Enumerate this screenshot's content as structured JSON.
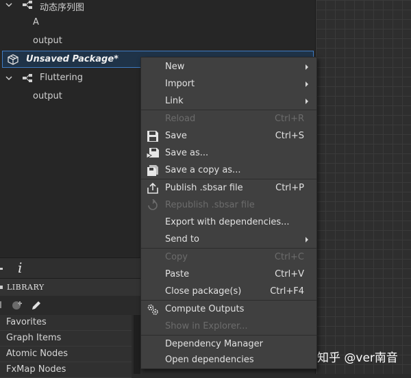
{
  "explorer": {
    "rows": [
      {
        "label": "动态序列图"
      },
      {
        "label": "A"
      },
      {
        "label": "output"
      },
      {
        "label": "Unsaved Package*"
      },
      {
        "label": "Fluttering"
      },
      {
        "label": "output"
      }
    ]
  },
  "toolbar": {
    "info_glyph": "i"
  },
  "library": {
    "title": "LIBRARY",
    "items": [
      "Favorites",
      "Graph Items",
      "Atomic Nodes",
      "FxMap Nodes"
    ]
  },
  "menu": {
    "items": [
      {
        "label": "New",
        "shortcut": ""
      },
      {
        "label": "Import",
        "shortcut": ""
      },
      {
        "label": "Link",
        "shortcut": ""
      },
      {
        "label": "Reload",
        "shortcut": "Ctrl+R"
      },
      {
        "label": "Save",
        "shortcut": "Ctrl+S"
      },
      {
        "label": "Save as...",
        "shortcut": ""
      },
      {
        "label": "Save a copy as...",
        "shortcut": ""
      },
      {
        "label": "Publish .sbsar file",
        "shortcut": "Ctrl+P"
      },
      {
        "label": "Republish .sbsar file",
        "shortcut": ""
      },
      {
        "label": "Export with dependencies...",
        "shortcut": ""
      },
      {
        "label": "Send to",
        "shortcut": ""
      },
      {
        "label": "Copy",
        "shortcut": "Ctrl+C"
      },
      {
        "label": "Paste",
        "shortcut": "Ctrl+V"
      },
      {
        "label": "Close package(s)",
        "shortcut": "Ctrl+F4"
      },
      {
        "label": "Compute Outputs",
        "shortcut": ""
      },
      {
        "label": "Show in Explorer...",
        "shortcut": ""
      },
      {
        "label": "Dependency Manager",
        "shortcut": ""
      },
      {
        "label": "Open dependencies",
        "shortcut": ""
      }
    ]
  },
  "watermark": "知乎 @ver南音",
  "colors": {
    "selection_border": "#3f7cc4",
    "menu_bg": "#404040",
    "disabled_text": "#6c6c6c"
  }
}
